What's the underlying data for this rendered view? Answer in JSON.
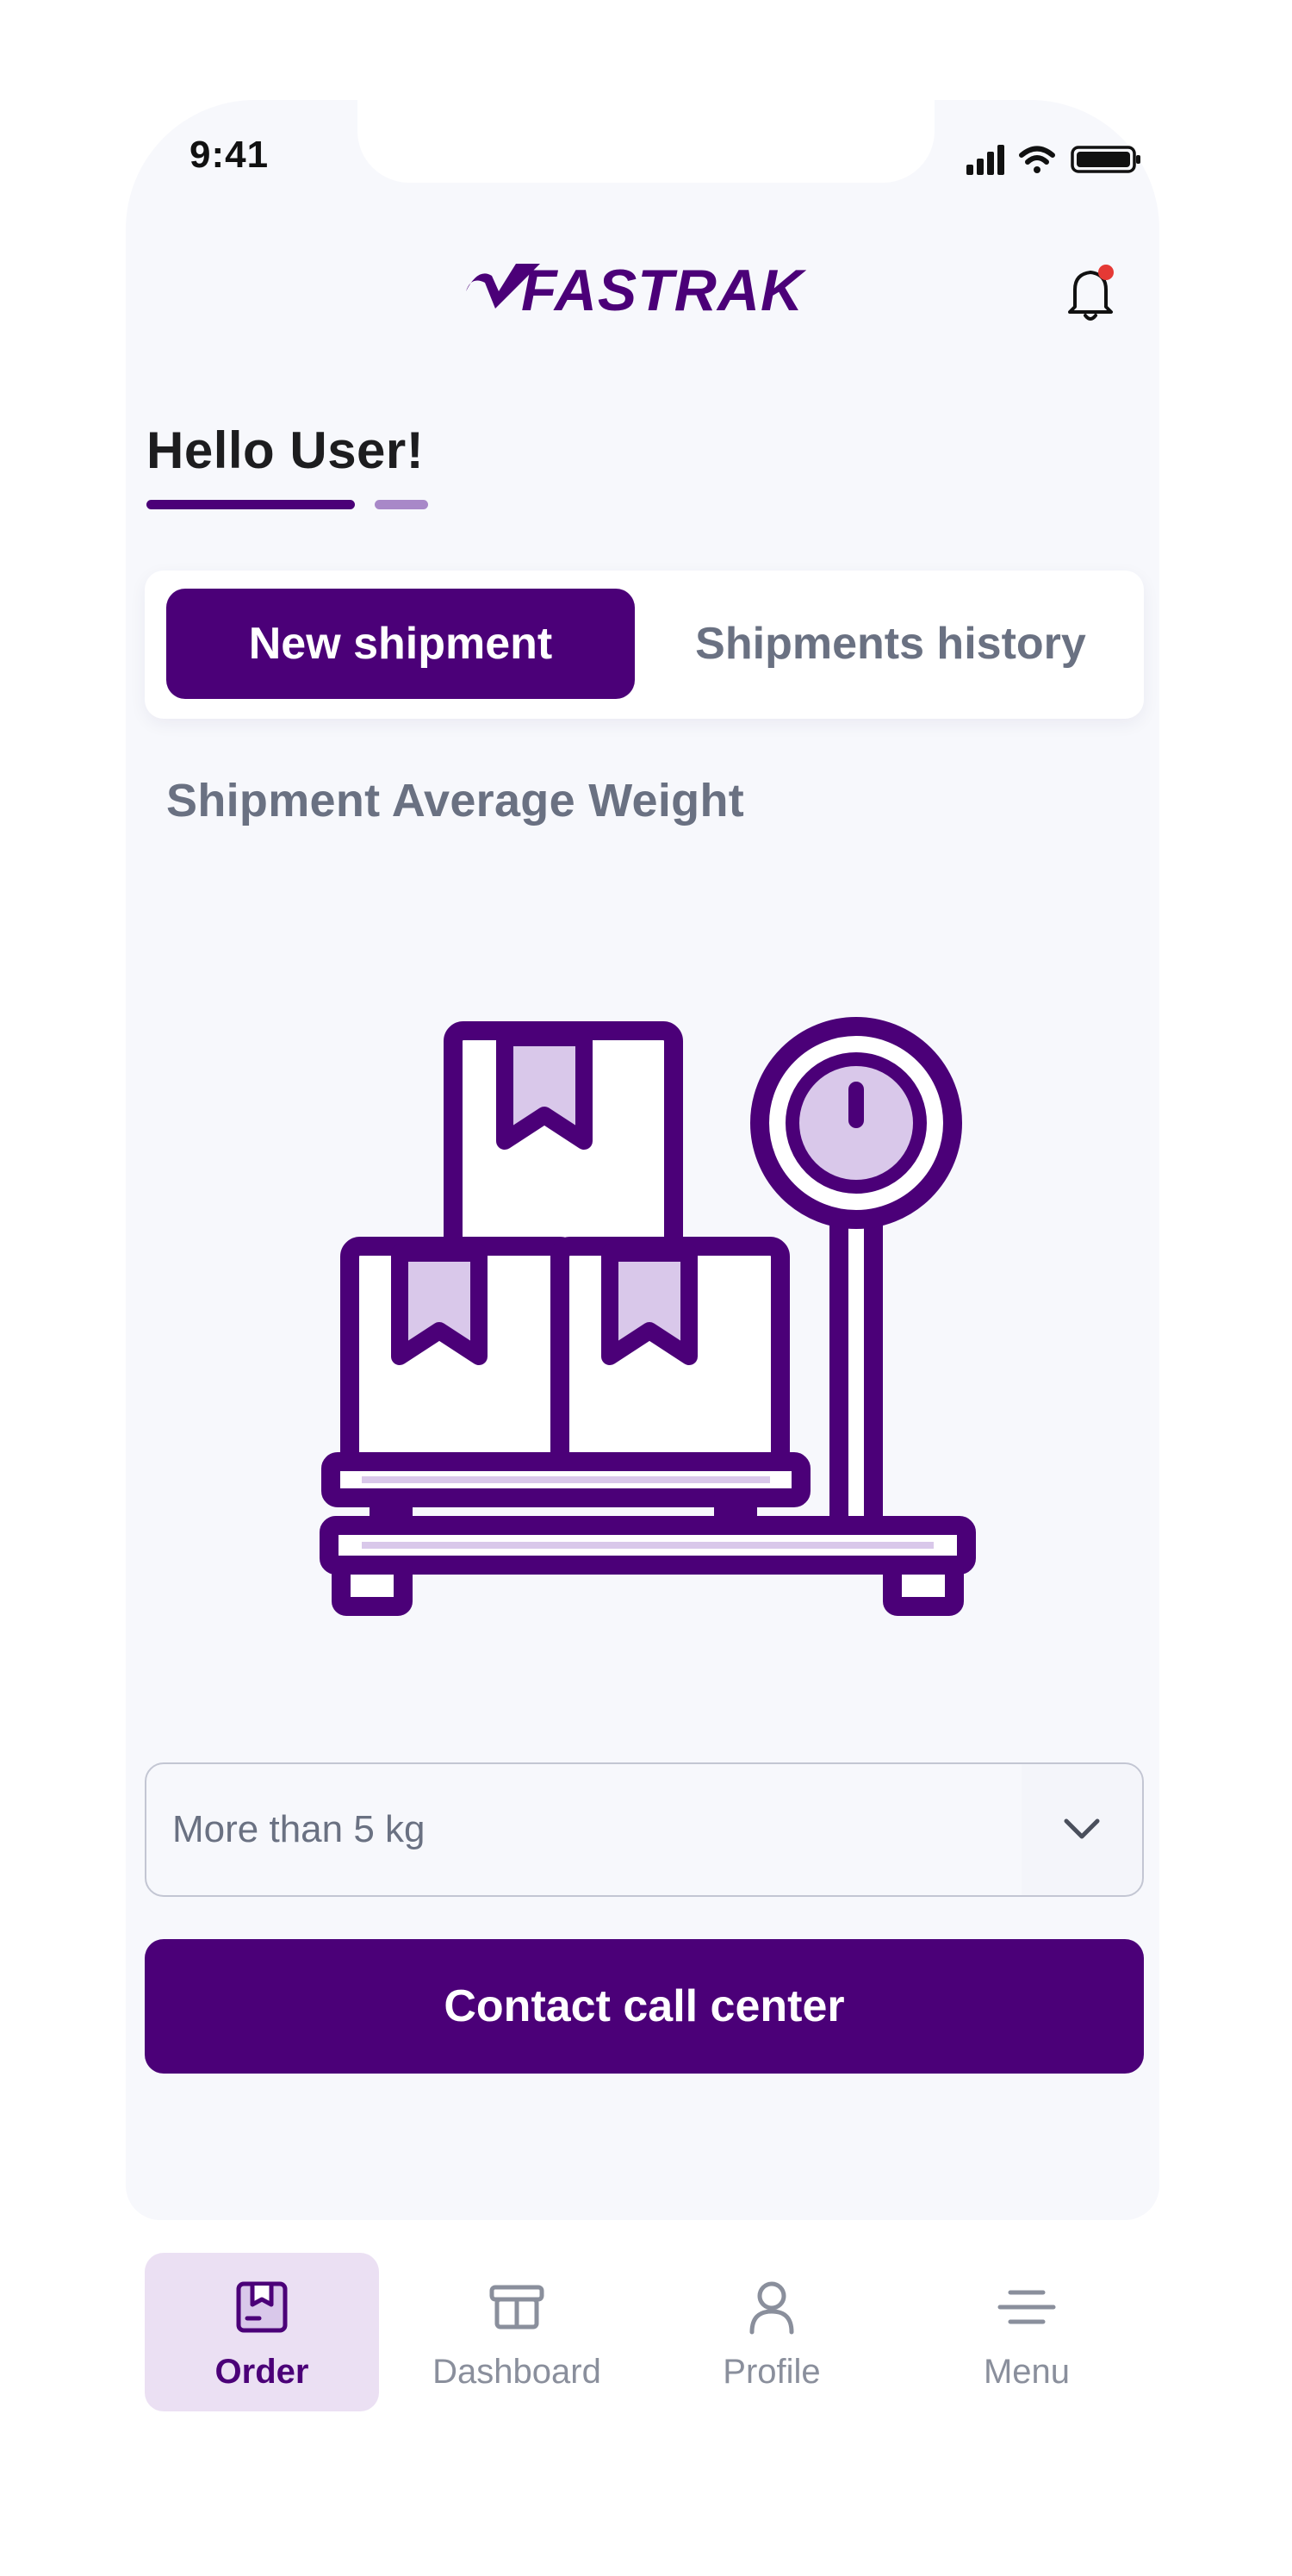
{
  "status_bar": {
    "time": "9:41"
  },
  "header": {
    "brand": "FASTRAK",
    "notification_dot": true
  },
  "greeting": "Hello User!",
  "tabs": [
    {
      "label": "New shipment",
      "active": true
    },
    {
      "label": "Shipments history",
      "active": false
    }
  ],
  "section_title": "Shipment Average Weight",
  "illustration": {
    "icon": "boxes-on-scale-icon"
  },
  "weight_select": {
    "value": "More than 5 kg",
    "icon": "chevron-down-icon"
  },
  "cta": {
    "label": "Contact call center"
  },
  "bottom_nav": [
    {
      "label": "Order",
      "icon": "order-box-icon",
      "active": true
    },
    {
      "label": "Dashboard",
      "icon": "dashboard-box-icon",
      "active": false
    },
    {
      "label": "Profile",
      "icon": "profile-icon",
      "active": false
    },
    {
      "label": "Menu",
      "icon": "menu-icon",
      "active": false
    }
  ],
  "colors": {
    "primary": "#4b0078",
    "accent_light": "#d9c8ea",
    "background": "#f7f8fc",
    "text_muted": "#6a7182",
    "notification": "#e53935"
  }
}
